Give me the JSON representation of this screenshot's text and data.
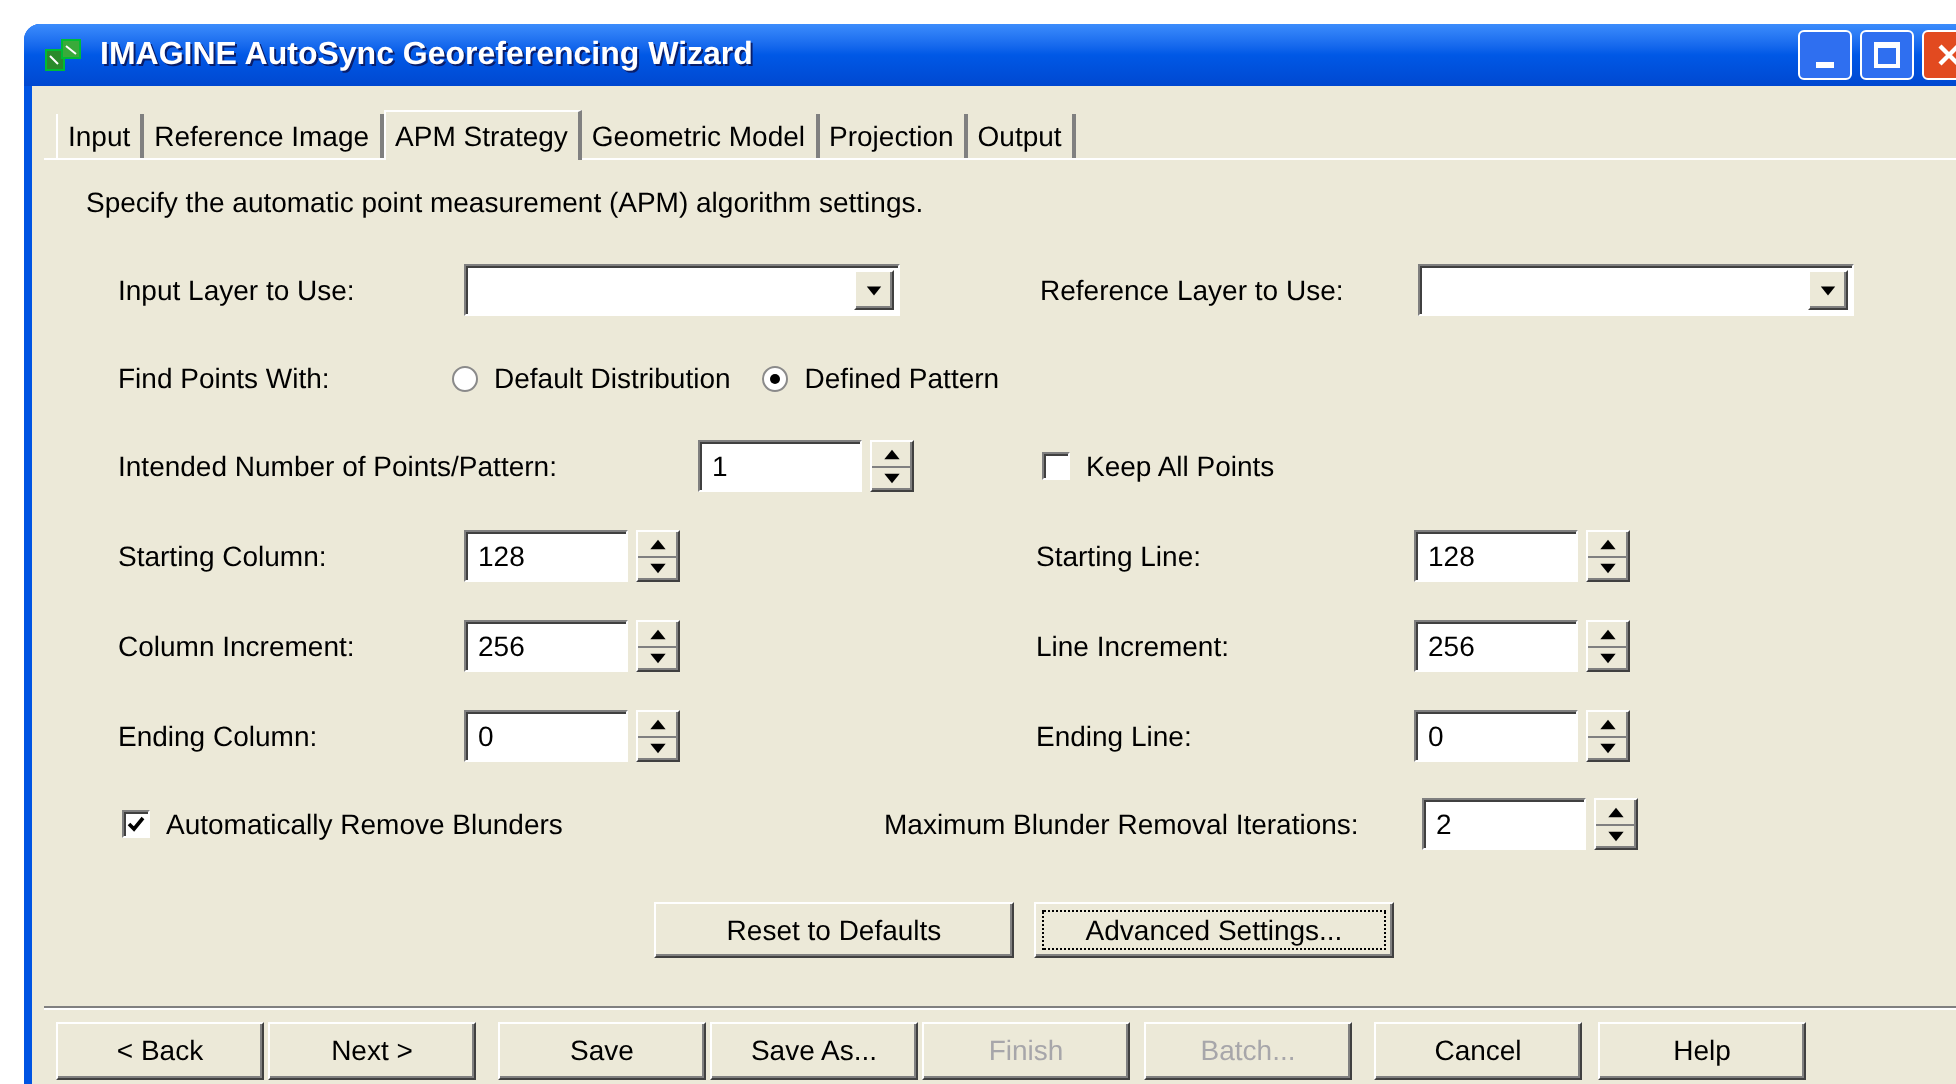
{
  "window": {
    "title": "IMAGINE AutoSync Georeferencing Wizard"
  },
  "tabs": [
    {
      "label": "Input",
      "selected": false
    },
    {
      "label": "Reference Image",
      "selected": false
    },
    {
      "label": "APM Strategy",
      "selected": true
    },
    {
      "label": "Geometric Model",
      "selected": false
    },
    {
      "label": "Projection",
      "selected": false
    },
    {
      "label": "Output",
      "selected": false
    }
  ],
  "instruction": "Specify the automatic point measurement (APM) algorithm settings.",
  "layers": [
    {
      "label": "Input Layer to Use:"
    },
    {
      "label": "Reference Layer to Use:"
    }
  ],
  "find_points": {
    "label": "Find Points With:",
    "options": [
      {
        "label": "Default Distribution",
        "selected": false
      },
      {
        "label": "Defined Pattern",
        "selected": true
      }
    ]
  },
  "points_per_pattern": {
    "label": "Intended Number of Points/Pattern:",
    "value": "1"
  },
  "keep_all_points": {
    "label": "Keep All Points",
    "checked": false
  },
  "spinners": [
    {
      "label": "Starting Column:",
      "value": "128"
    },
    {
      "label": "Starting Line:",
      "value": "128"
    },
    {
      "label": "Column Increment:",
      "value": "256"
    },
    {
      "label": "Line Increment:",
      "value": "256"
    },
    {
      "label": "Ending Column:",
      "value": "0"
    },
    {
      "label": "Ending Line:",
      "value": "0"
    }
  ],
  "remove_blunders": {
    "label": "Automatically Remove Blunders",
    "checked": true
  },
  "max_iterations": {
    "label": "Maximum Blunder Removal Iterations:",
    "value": "2"
  },
  "action_buttons": [
    {
      "label": "Reset to Defaults",
      "focused": false
    },
    {
      "label": "Advanced Settings...",
      "focused": true
    }
  ],
  "nav_buttons": [
    {
      "label": "< Back",
      "disabled": false
    },
    {
      "label": "Next >",
      "disabled": false
    },
    {
      "label": "Save",
      "disabled": false
    },
    {
      "label": "Save As...",
      "disabled": false
    },
    {
      "label": "Finish",
      "disabled": true
    },
    {
      "label": "Batch...",
      "disabled": true
    },
    {
      "label": "Cancel",
      "disabled": false
    },
    {
      "label": "Help",
      "disabled": false
    }
  ]
}
